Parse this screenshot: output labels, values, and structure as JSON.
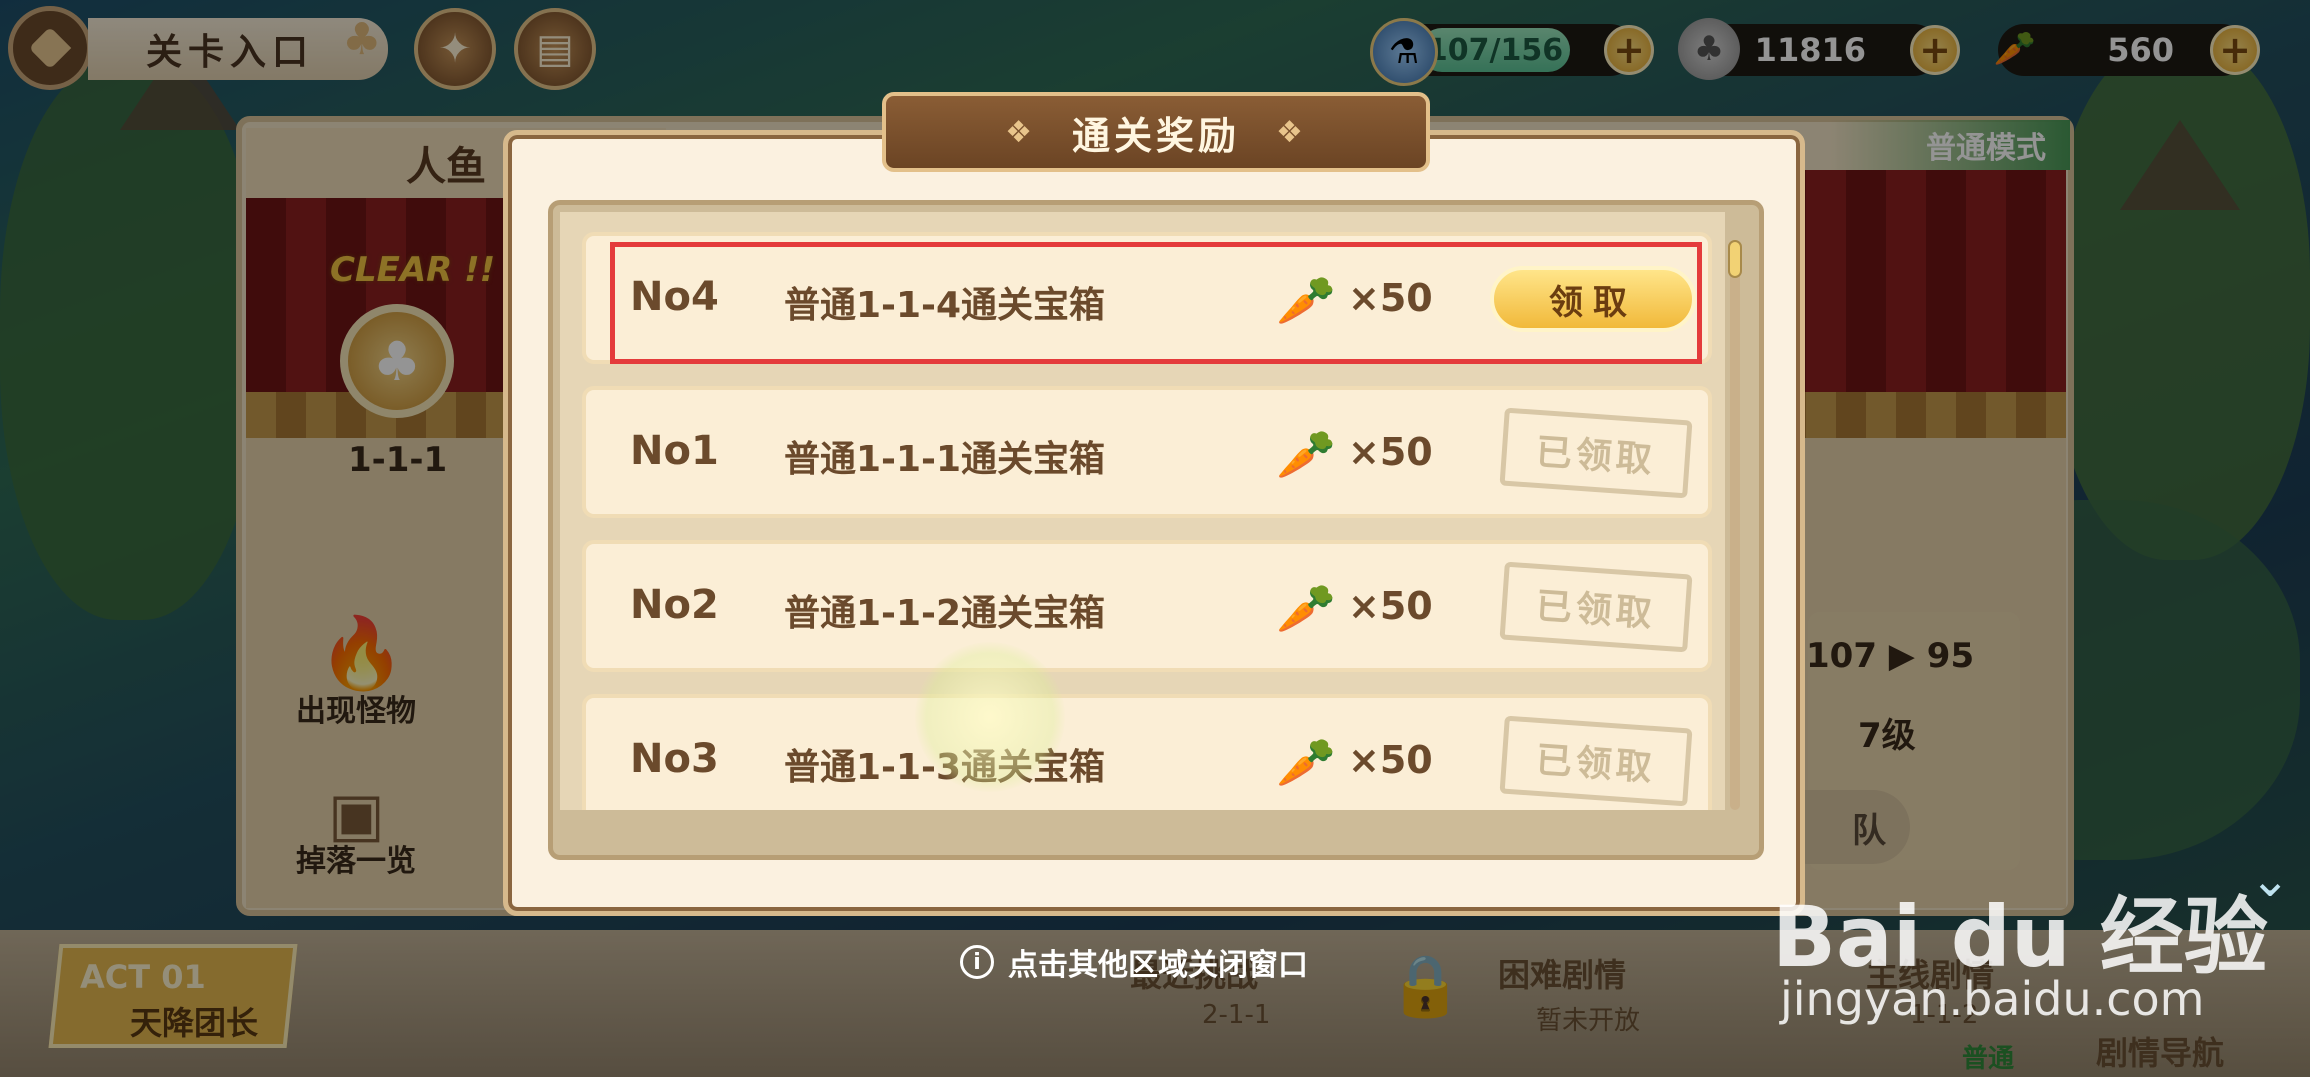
{
  "topbar": {
    "stage_entry_label": "关卡入口",
    "energy": "107/156",
    "clover_currency": "11816",
    "carrot_currency": "560",
    "plus": "+"
  },
  "stage_panel": {
    "title": "人鱼",
    "mode": "普通模式",
    "clear_text": "CLEAR !!",
    "node_label": "1-1-1",
    "monsters_label": "出现怪物",
    "drops_label": "掉落一览",
    "info_power": "107 ▶ 95",
    "info_level": "7级",
    "team_button": "队"
  },
  "modal": {
    "title": "通关奖励",
    "rewards": [
      {
        "no": "No4",
        "name": "普通1-1-4通关宝箱",
        "qty": "×50",
        "status": "claim",
        "button": "领取"
      },
      {
        "no": "No1",
        "name": "普通1-1-1通关宝箱",
        "qty": "×50",
        "status": "claimed",
        "button": "已领取"
      },
      {
        "no": "No2",
        "name": "普通1-1-2通关宝箱",
        "qty": "×50",
        "status": "claimed",
        "button": "已领取"
      },
      {
        "no": "No3",
        "name": "普通1-1-3通关宝箱",
        "qty": "×50",
        "status": "claimed",
        "button": "已领取"
      }
    ],
    "close_hint": "点击其他区域关闭窗口"
  },
  "bottom_nav": {
    "act_no": "ACT 01",
    "act_name": "天降团长",
    "latest_title": "最近挑战",
    "latest_stage": "2-1-1",
    "hard_title": "困难剧情",
    "hard_sub": "暂未开放",
    "main_title": "主线剧情",
    "main_stage": "1-1-2",
    "main_mode": "普通",
    "story_nav": "剧情导航"
  },
  "watermark": {
    "main": "Bai du 经验",
    "sub": "jingyan.baidu.com"
  },
  "colors": {
    "highlight": "#e43b3b",
    "accent": "#f1b93a"
  }
}
